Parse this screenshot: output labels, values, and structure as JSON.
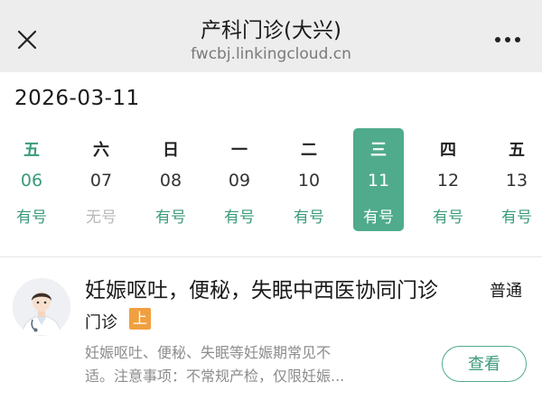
{
  "header": {
    "title": "产科门诊(大兴)",
    "subtitle": "fwcbj.linkingcloud.cn",
    "close_icon": "close-icon",
    "more_icon": "more-dots-icon"
  },
  "date": "2026-03-11",
  "days": [
    {
      "weekday": "五",
      "date": "06",
      "availability": "有号",
      "available": true,
      "selected": false
    },
    {
      "weekday": "六",
      "date": "07",
      "availability": "无号",
      "available": false,
      "selected": false
    },
    {
      "weekday": "日",
      "date": "08",
      "availability": "有号",
      "available": true,
      "selected": false
    },
    {
      "weekday": "一",
      "date": "09",
      "availability": "有号",
      "available": true,
      "selected": false
    },
    {
      "weekday": "二",
      "date": "10",
      "availability": "有号",
      "available": true,
      "selected": false
    },
    {
      "weekday": "三",
      "date": "11",
      "availability": "有号",
      "available": true,
      "selected": true
    },
    {
      "weekday": "四",
      "date": "12",
      "availability": "有号",
      "available": true,
      "selected": false
    },
    {
      "weekday": "五",
      "date": "13",
      "availability": "有号",
      "available": true,
      "selected": false
    }
  ],
  "clinic": {
    "name": "妊娠呕吐，便秘，失眠中西医协同门诊",
    "type_part1": "普通",
    "type_part2": "门诊",
    "session_badge": "上",
    "description_line1": "妊娠呕吐、便秘、失眠等妊娠期常见不",
    "description_line2": "适。注意事项：不常规产检，仅限妊娠...",
    "view_button": "查看",
    "avatar_icon": "doctor-avatar-icon"
  },
  "colors": {
    "accent": "#4fab8b",
    "accent_text": "#3a9a7c",
    "badge": "#f0a040",
    "unavailable": "#b8b8b8"
  }
}
